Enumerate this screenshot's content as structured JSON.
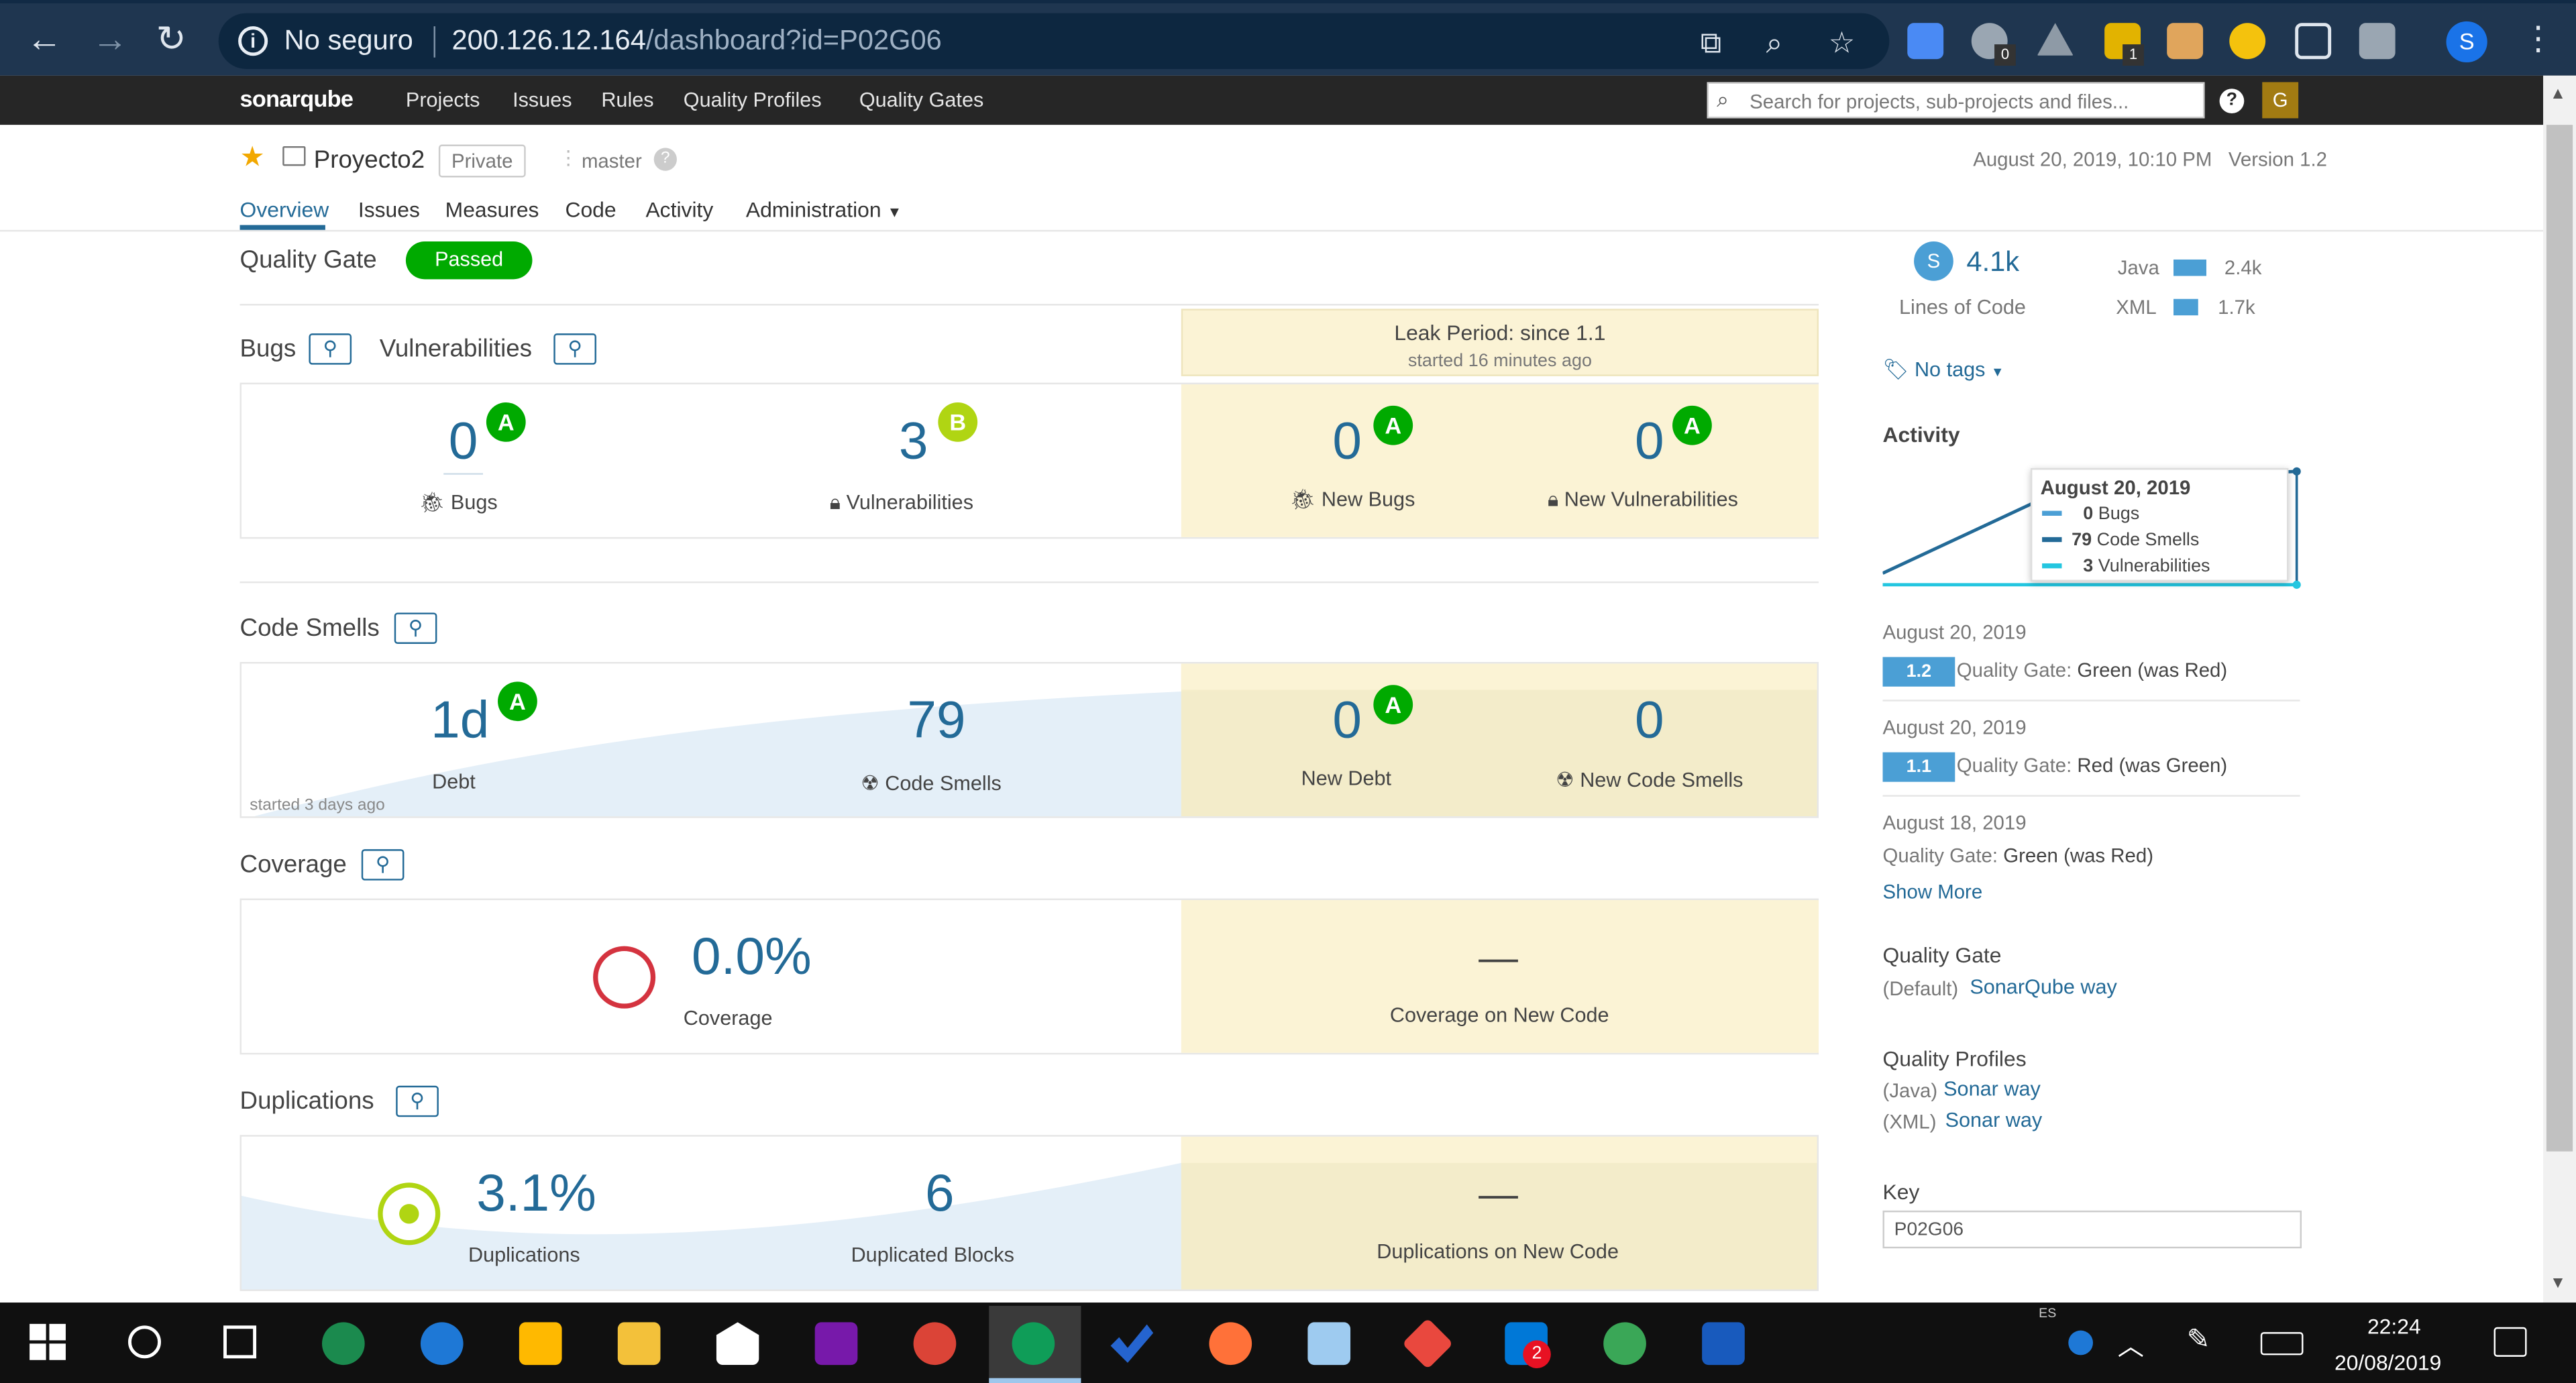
{
  "browser": {
    "insecure_label": "No seguro",
    "url_host": "200.126.12.164",
    "url_path": "/dashboard?id=P02G06",
    "profile_initial": "S",
    "ext_badge_1": "0",
    "ext_badge_2": "1"
  },
  "nav": {
    "logo": "sonarqube",
    "items": [
      "Projects",
      "Issues",
      "Rules",
      "Quality Profiles",
      "Quality Gates"
    ],
    "search_placeholder": "Search for projects, sub-projects and files...",
    "user_initial": "G"
  },
  "project": {
    "name": "Proyecto2",
    "visibility": "Private",
    "branch": "master",
    "analysis_date": "August 20, 2019, 10:10 PM",
    "version": "Version 1.2",
    "tabs": [
      "Overview",
      "Issues",
      "Measures",
      "Code",
      "Activity",
      "Administration"
    ]
  },
  "quality_gate": {
    "label": "Quality Gate",
    "status": "Passed"
  },
  "leak": {
    "title": "Leak Period: since 1.1",
    "subtitle": "started 16 minutes ago"
  },
  "bugs_vulns": {
    "bugs_title": "Bugs",
    "vulns_title": "Vulnerabilities",
    "bugs": {
      "value": "0",
      "rating": "A",
      "label": "Bugs"
    },
    "vulns": {
      "value": "3",
      "rating": "B",
      "label": "Vulnerabilities"
    },
    "new_bugs": {
      "value": "0",
      "rating": "A",
      "label": "New Bugs"
    },
    "new_vulns": {
      "value": "0",
      "rating": "A",
      "label": "New Vulnerabilities"
    }
  },
  "code_smells": {
    "title": "Code Smells",
    "debt": {
      "value": "1d",
      "rating": "A",
      "label": "Debt"
    },
    "smells": {
      "value": "79",
      "label": "Code Smells"
    },
    "started": "started 3 days ago",
    "new_debt": {
      "value": "0",
      "rating": "A",
      "label": "New Debt"
    },
    "new_smells": {
      "value": "0",
      "label": "New Code Smells"
    }
  },
  "coverage": {
    "title": "Coverage",
    "value": "0.0%",
    "label": "Coverage",
    "new_value": "—",
    "new_label": "Coverage on New Code"
  },
  "duplications": {
    "title": "Duplications",
    "value": "3.1%",
    "label": "Duplications",
    "blocks": "6",
    "blocks_label": "Duplicated Blocks",
    "new_value": "—",
    "new_label": "Duplications on New Code"
  },
  "sidebar": {
    "loc_value": "4.1k",
    "loc_label": "Lines of Code",
    "loc_badge": "S",
    "languages": [
      {
        "name": "Java",
        "value": "2.4k",
        "fraction": 0.59
      },
      {
        "name": "XML",
        "value": "1.7k",
        "fraction": 0.41
      }
    ],
    "tags": "No tags",
    "activity_title": "Activity",
    "tooltip": {
      "date": "August 20, 2019",
      "rows": [
        {
          "value": "0",
          "label": "Bugs",
          "color": "#4b9fd5"
        },
        {
          "value": "79",
          "label": "Code Smells",
          "color": "#236a97"
        },
        {
          "value": "3",
          "label": "Vulnerabilities",
          "color": "#24c6e0"
        }
      ]
    },
    "events": [
      {
        "date": "August 20, 2019",
        "version": "1.2",
        "text": "Quality Gate: ",
        "status": "Green (was Red)"
      },
      {
        "date": "August 20, 2019",
        "version": "1.1",
        "text": "Quality Gate: ",
        "status": "Red (was Green)"
      },
      {
        "date": "August 18, 2019",
        "version": "",
        "text": "Quality Gate: ",
        "status": "Green (was Red)"
      }
    ],
    "show_more": "Show More",
    "qg_title": "Quality Gate",
    "qg_default": "(Default)",
    "qg_link": "SonarQube way",
    "qp_title": "Quality Profiles",
    "qp": [
      {
        "lang": "(Java)",
        "link": "Sonar way"
      },
      {
        "lang": "(XML)",
        "link": "Sonar way"
      }
    ],
    "key_title": "Key",
    "key_value": "P02G06"
  },
  "taskbar": {
    "lang": "ES",
    "time": "22:24",
    "date": "20/08/2019",
    "badge": "2"
  }
}
